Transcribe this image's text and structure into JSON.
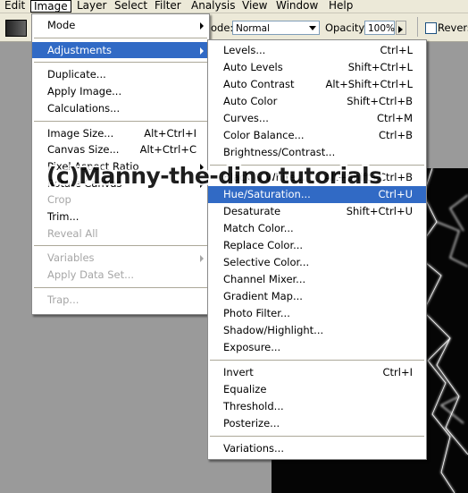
{
  "menubar": {
    "items": [
      "Edit",
      "Image",
      "Layer",
      "Select",
      "Filter",
      "Analysis",
      "View",
      "Window",
      "Help"
    ],
    "active_index": 1
  },
  "options": {
    "mode_label_partial": "ode:",
    "mode_value": "Normal",
    "opacity_label": "Opacity:",
    "opacity_value": "100%",
    "reverse_label": "Reverse"
  },
  "image_menu": [
    {
      "label": "Mode",
      "submenu": true
    },
    {
      "sep": true
    },
    {
      "label": "Adjustments",
      "submenu": true,
      "highlighted": true
    },
    {
      "sep": true
    },
    {
      "label": "Duplicate..."
    },
    {
      "label": "Apply Image..."
    },
    {
      "label": "Calculations..."
    },
    {
      "sep": true
    },
    {
      "label": "Image Size...",
      "shortcut": "Alt+Ctrl+I"
    },
    {
      "label": "Canvas Size...",
      "shortcut": "Alt+Ctrl+C"
    },
    {
      "label": "Pixel Aspect Ratio",
      "submenu": true
    },
    {
      "label": "Rotate Canvas",
      "submenu": true
    },
    {
      "label": "Crop",
      "disabled": true
    },
    {
      "label": "Trim..."
    },
    {
      "label": "Reveal All",
      "disabled": true
    },
    {
      "sep": true
    },
    {
      "label": "Variables",
      "submenu": true,
      "disabled": true
    },
    {
      "label": "Apply Data Set...",
      "disabled": true
    },
    {
      "sep": true
    },
    {
      "label": "Trap...",
      "disabled": true
    }
  ],
  "adjustments_menu": [
    {
      "label": "Levels...",
      "shortcut": "Ctrl+L"
    },
    {
      "label": "Auto Levels",
      "shortcut": "Shift+Ctrl+L"
    },
    {
      "label": "Auto Contrast",
      "shortcut": "Alt+Shift+Ctrl+L"
    },
    {
      "label": "Auto Color",
      "shortcut": "Shift+Ctrl+B"
    },
    {
      "label": "Curves...",
      "shortcut": "Ctrl+M"
    },
    {
      "label": "Color Balance...",
      "shortcut": "Ctrl+B"
    },
    {
      "label": "Brightness/Contrast..."
    },
    {
      "sep": true
    },
    {
      "label": "Black & White...",
      "shortcut": "Alt+Shift+Ctrl+B"
    },
    {
      "label": "Hue/Saturation...",
      "shortcut": "Ctrl+U",
      "highlighted": true
    },
    {
      "label": "Desaturate",
      "shortcut": "Shift+Ctrl+U"
    },
    {
      "label": "Match Color..."
    },
    {
      "label": "Replace Color..."
    },
    {
      "label": "Selective Color..."
    },
    {
      "label": "Channel Mixer..."
    },
    {
      "label": "Gradient Map..."
    },
    {
      "label": "Photo Filter..."
    },
    {
      "label": "Shadow/Highlight..."
    },
    {
      "label": "Exposure..."
    },
    {
      "sep": true
    },
    {
      "label": "Invert",
      "shortcut": "Ctrl+I"
    },
    {
      "label": "Equalize"
    },
    {
      "label": "Threshold..."
    },
    {
      "label": "Posterize..."
    },
    {
      "sep": true
    },
    {
      "label": "Variations..."
    }
  ],
  "watermark": "(c)Manny-the-dino tutorials",
  "colors": {
    "highlight": "#316ac5",
    "menubar_bg": "#ece9d8",
    "disabled_text": "#a6a6a6"
  }
}
